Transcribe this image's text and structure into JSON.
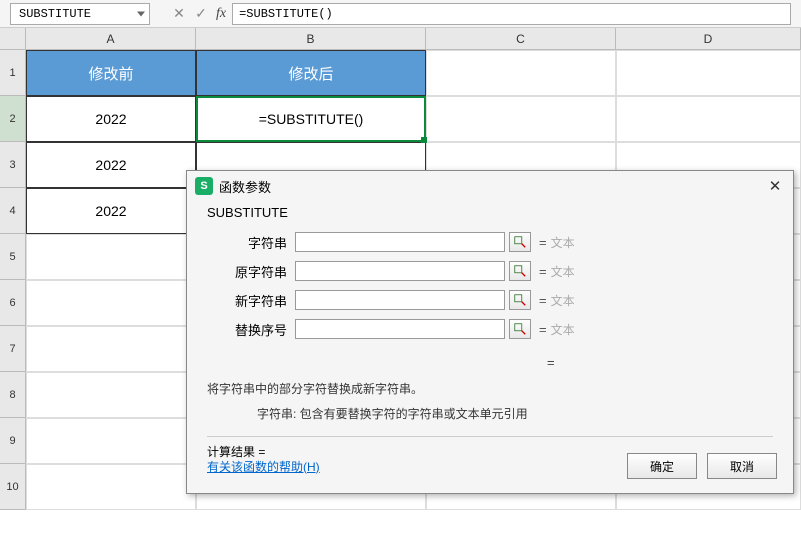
{
  "namebox": "SUBSTITUTE",
  "formula": "=SUBSTITUTE()",
  "columns": [
    "A",
    "B",
    "C",
    "D"
  ],
  "row_numbers": [
    "1",
    "2",
    "3",
    "4",
    "5",
    "6",
    "7",
    "8",
    "9",
    "10"
  ],
  "headers": {
    "a": "修改前",
    "b": "修改后"
  },
  "cells": {
    "a2": "2022",
    "b2": "=SUBSTITUTE()",
    "a3": "2022",
    "a4": "2022"
  },
  "dialog": {
    "title": "函数参数",
    "func": "SUBSTITUTE",
    "params": [
      {
        "label": "字符串",
        "hint": "文本"
      },
      {
        "label": "原字符串",
        "hint": "文本"
      },
      {
        "label": "新字符串",
        "hint": "文本"
      },
      {
        "label": "替换序号",
        "hint": "文本"
      }
    ],
    "desc1": "将字符串中的部分字符替换成新字符串。",
    "desc2": "字符串:  包含有要替换字符的字符串或文本单元引用",
    "calc": "计算结果 =",
    "help": "有关该函数的帮助(H)",
    "ok": "确定",
    "cancel": "取消"
  },
  "eq": "="
}
